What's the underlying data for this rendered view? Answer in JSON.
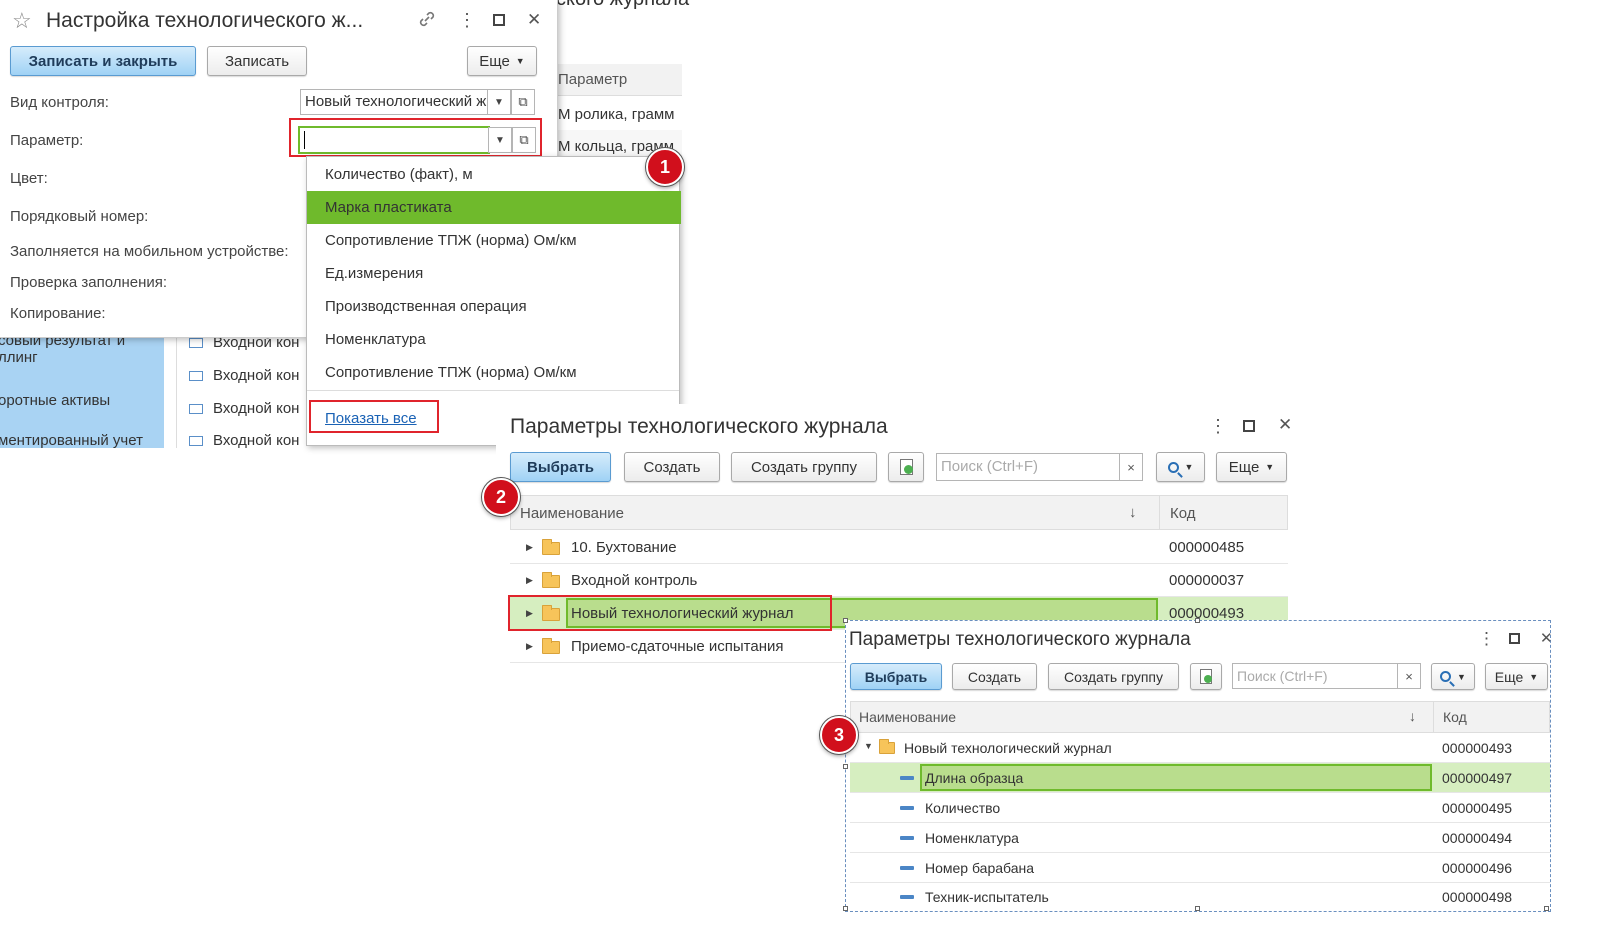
{
  "bg_window": {
    "title_fragment": "ского журнала",
    "column_header": "Параметр",
    "rows": [
      "М ролика, грамм",
      "М кольца, грамм"
    ],
    "sidebar_items": [
      "совый результат и\nллинг",
      "оротные активы",
      "ментированный учет"
    ],
    "list_items": [
      "Входной кон",
      "Входной кон",
      "Входной кон",
      "Входной кон"
    ]
  },
  "settings_form": {
    "title": "Настройка технологического ж...",
    "save_close_label": "Записать и закрыть",
    "save_label": "Записать",
    "more_label": "Еще",
    "labels": {
      "control_type": "Вид контроля:",
      "parameter": "Параметр:",
      "color": "Цвет:",
      "order_number": "Порядковый номер:",
      "mobile": "Заполняется на мобильном устройстве:",
      "fill_check": "Проверка заполнения:",
      "copying": "Копирование:"
    },
    "control_type_value": "Новый технологический ж",
    "parameter_value": ""
  },
  "dropdown": {
    "items": [
      "Количество (факт), м",
      "Марка пластиката",
      "Сопротивление ТПЖ (норма) Ом/км",
      "Ед.измерения",
      "Производственная операция",
      "Номенклатура",
      "Сопротивление ТПЖ (норма) Ом/км"
    ],
    "selected_index": 1,
    "show_all": "Показать все"
  },
  "params_dialog": {
    "title": "Параметры технологического журнала",
    "select_label": "Выбрать",
    "create_label": "Создать",
    "create_group_label": "Создать группу",
    "search_placeholder": "Поиск (Ctrl+F)",
    "clear_glyph": "×",
    "more_label": "Еще",
    "col_name": "Наименование",
    "col_code": "Код",
    "sort_glyph": "↓",
    "rows": [
      {
        "name": "10. Бухтование",
        "code": "000000485"
      },
      {
        "name": "Входной контроль",
        "code": "000000037"
      },
      {
        "name": "Новый технологический журнал",
        "code": "000000493"
      },
      {
        "name": "Приемо-сдаточные испытания",
        "code": ""
      }
    ]
  },
  "params_dialog2": {
    "title": "Параметры технологического журнала",
    "select_label": "Выбрать",
    "create_label": "Создать",
    "create_group_label": "Создать группу",
    "search_placeholder": "Поиск (Ctrl+F)",
    "clear_glyph": "×",
    "more_label": "Еще",
    "col_name": "Наименование",
    "col_code": "Код",
    "sort_glyph": "↓",
    "group": {
      "name": "Новый технологический журнал",
      "code": "000000493"
    },
    "rows": [
      {
        "name": "Длина образца",
        "code": "000000497"
      },
      {
        "name": "Количество",
        "code": "000000495"
      },
      {
        "name": "Номенклатура",
        "code": "000000494"
      },
      {
        "name": "Номер барабана",
        "code": "000000496"
      },
      {
        "name": "Техник-испытатель",
        "code": "000000498"
      }
    ]
  },
  "badges": [
    "1",
    "2",
    "3"
  ],
  "icons": {
    "star": "☆",
    "link": "🔗",
    "kebab": "⋮",
    "maximize": "☐",
    "close": "✕",
    "drop": "▾",
    "open": "⧉",
    "expand": "▸",
    "collapse": "▾"
  },
  "colors": {
    "selection_green": "#6fba2c",
    "row_highlight": "#b9dd8d",
    "primary_button": "#9fd2f5",
    "annotation_red": "#e0242c",
    "badge_red": "#d10f1c"
  }
}
